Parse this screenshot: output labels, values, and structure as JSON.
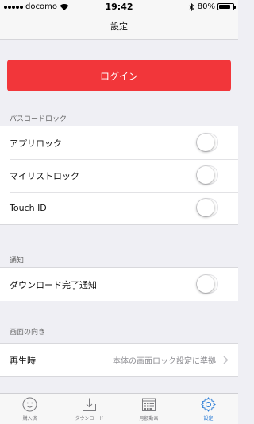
{
  "status_bar": {
    "carrier": "docomo",
    "time": "19:42",
    "battery_percent": "80%",
    "battery_level": 0.8
  },
  "nav": {
    "title": "設定"
  },
  "login": {
    "label": "ログイン"
  },
  "passcode_section": {
    "header": "パスコードロック",
    "rows": [
      {
        "label": "アプリロック",
        "toggle_on": false
      },
      {
        "label": "マイリストロック",
        "toggle_on": false
      },
      {
        "label": "Touch ID",
        "toggle_on": false
      }
    ]
  },
  "notification_section": {
    "header": "通知",
    "rows": [
      {
        "label": "ダウンロード完了通知",
        "toggle_on": false
      }
    ]
  },
  "orientation_section": {
    "header": "画面の向き",
    "rows": [
      {
        "label": "再生時",
        "value": "本体の画面ロック設定に準拠"
      }
    ]
  },
  "tabs": [
    {
      "label": "購入済",
      "icon": "smiley-icon",
      "active": false
    },
    {
      "label": "ダウンロード",
      "icon": "download-icon",
      "active": false
    },
    {
      "label": "月額動画",
      "icon": "calendar-grid-icon",
      "active": false
    },
    {
      "label": "設定",
      "icon": "gear-icon",
      "active": true
    }
  ],
  "colors": {
    "accent_red": "#f2363a",
    "active_tab": "#2f7fd7",
    "background": "#efeff4"
  }
}
